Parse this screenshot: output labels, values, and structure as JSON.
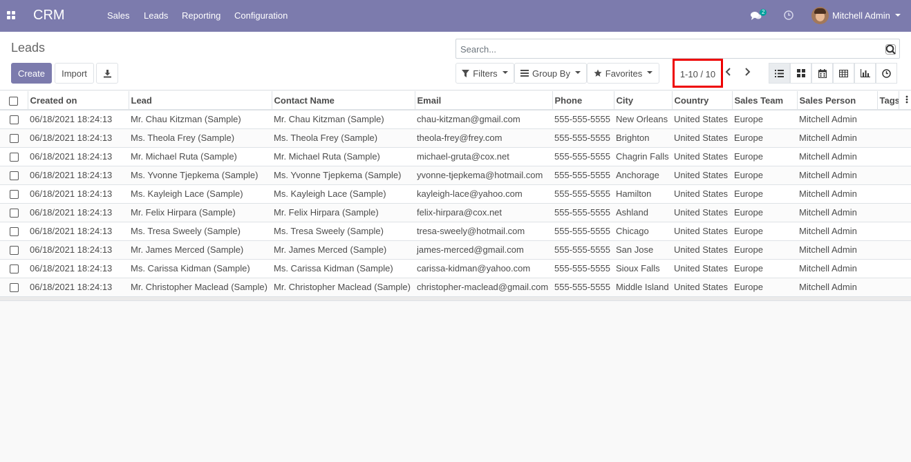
{
  "navbar": {
    "brand": "CRM",
    "menu": [
      {
        "label": "Sales"
      },
      {
        "label": "Leads"
      },
      {
        "label": "Reporting"
      },
      {
        "label": "Configuration"
      }
    ],
    "chat_count": "2",
    "user_name": "Mitchell Admin",
    "icons": {
      "apps": "apps-grid-icon",
      "chat": "chat-bubbles-icon",
      "activity": "clock-icon"
    },
    "bar_color": "#7c7bad"
  },
  "control_panel": {
    "breadcrumb": "Leads",
    "create_label": "Create",
    "import_label": "Import",
    "download_icon": "download-icon",
    "search": {
      "placeholder": "Search...",
      "value": ""
    },
    "filters_label": "Filters",
    "groupby_label": "Group By",
    "favorites_label": "Favorites",
    "pager_value": "1-10 / 10",
    "views": [
      "list",
      "kanban",
      "calendar",
      "pivot",
      "graph",
      "activity"
    ],
    "active_view": "list",
    "accent_color": "#7c7bad",
    "highlight_color": "#e00000"
  },
  "table": {
    "columns": [
      "Created on",
      "Lead",
      "Contact Name",
      "Email",
      "Phone",
      "City",
      "Country",
      "Sales Team",
      "Sales Person",
      "Tags"
    ],
    "rows": [
      {
        "created_on": "06/18/2021 18:24:13",
        "lead": "Mr. Chau Kitzman (Sample)",
        "contact": "Mr. Chau Kitzman (Sample)",
        "email": "chau-kitzman@gmail.com",
        "phone": "555-555-5555",
        "city": "New Orleans",
        "country": "United States",
        "team": "Europe",
        "person": "Mitchell Admin",
        "tags": ""
      },
      {
        "created_on": "06/18/2021 18:24:13",
        "lead": "Ms. Theola Frey (Sample)",
        "contact": "Ms. Theola Frey (Sample)",
        "email": "theola-frey@frey.com",
        "phone": "555-555-5555",
        "city": "Brighton",
        "country": "United States",
        "team": "Europe",
        "person": "Mitchell Admin",
        "tags": ""
      },
      {
        "created_on": "06/18/2021 18:24:13",
        "lead": "Mr. Michael Ruta (Sample)",
        "contact": "Mr. Michael Ruta (Sample)",
        "email": "michael-gruta@cox.net",
        "phone": "555-555-5555",
        "city": "Chagrin Falls",
        "country": "United States",
        "team": "Europe",
        "person": "Mitchell Admin",
        "tags": ""
      },
      {
        "created_on": "06/18/2021 18:24:13",
        "lead": "Ms. Yvonne Tjepkema (Sample)",
        "contact": "Ms. Yvonne Tjepkema (Sample)",
        "email": "yvonne-tjepkema@hotmail.com",
        "phone": "555-555-5555",
        "city": "Anchorage",
        "country": "United States",
        "team": "Europe",
        "person": "Mitchell Admin",
        "tags": ""
      },
      {
        "created_on": "06/18/2021 18:24:13",
        "lead": "Ms. Kayleigh Lace (Sample)",
        "contact": "Ms. Kayleigh Lace (Sample)",
        "email": "kayleigh-lace@yahoo.com",
        "phone": "555-555-5555",
        "city": "Hamilton",
        "country": "United States",
        "team": "Europe",
        "person": "Mitchell Admin",
        "tags": ""
      },
      {
        "created_on": "06/18/2021 18:24:13",
        "lead": "Mr. Felix Hirpara (Sample)",
        "contact": "Mr. Felix Hirpara (Sample)",
        "email": "felix-hirpara@cox.net",
        "phone": "555-555-5555",
        "city": "Ashland",
        "country": "United States",
        "team": "Europe",
        "person": "Mitchell Admin",
        "tags": ""
      },
      {
        "created_on": "06/18/2021 18:24:13",
        "lead": "Ms. Tresa Sweely (Sample)",
        "contact": "Ms. Tresa Sweely (Sample)",
        "email": "tresa-sweely@hotmail.com",
        "phone": "555-555-5555",
        "city": "Chicago",
        "country": "United States",
        "team": "Europe",
        "person": "Mitchell Admin",
        "tags": ""
      },
      {
        "created_on": "06/18/2021 18:24:13",
        "lead": "Mr. James Merced (Sample)",
        "contact": "Mr. James Merced (Sample)",
        "email": "james-merced@gmail.com",
        "phone": "555-555-5555",
        "city": "San Jose",
        "country": "United States",
        "team": "Europe",
        "person": "Mitchell Admin",
        "tags": ""
      },
      {
        "created_on": "06/18/2021 18:24:13",
        "lead": "Ms. Carissa Kidman (Sample)",
        "contact": "Ms. Carissa Kidman (Sample)",
        "email": "carissa-kidman@yahoo.com",
        "phone": "555-555-5555",
        "city": "Sioux Falls",
        "country": "United States",
        "team": "Europe",
        "person": "Mitchell Admin",
        "tags": ""
      },
      {
        "created_on": "06/18/2021 18:24:13",
        "lead": "Mr. Christopher Maclead (Sample)",
        "contact": "Mr. Christopher Maclead (Sample)",
        "email": "christopher-maclead@gmail.com",
        "phone": "555-555-5555",
        "city": "Middle Island",
        "country": "United States",
        "team": "Europe",
        "person": "Mitchell Admin",
        "tags": ""
      }
    ]
  }
}
